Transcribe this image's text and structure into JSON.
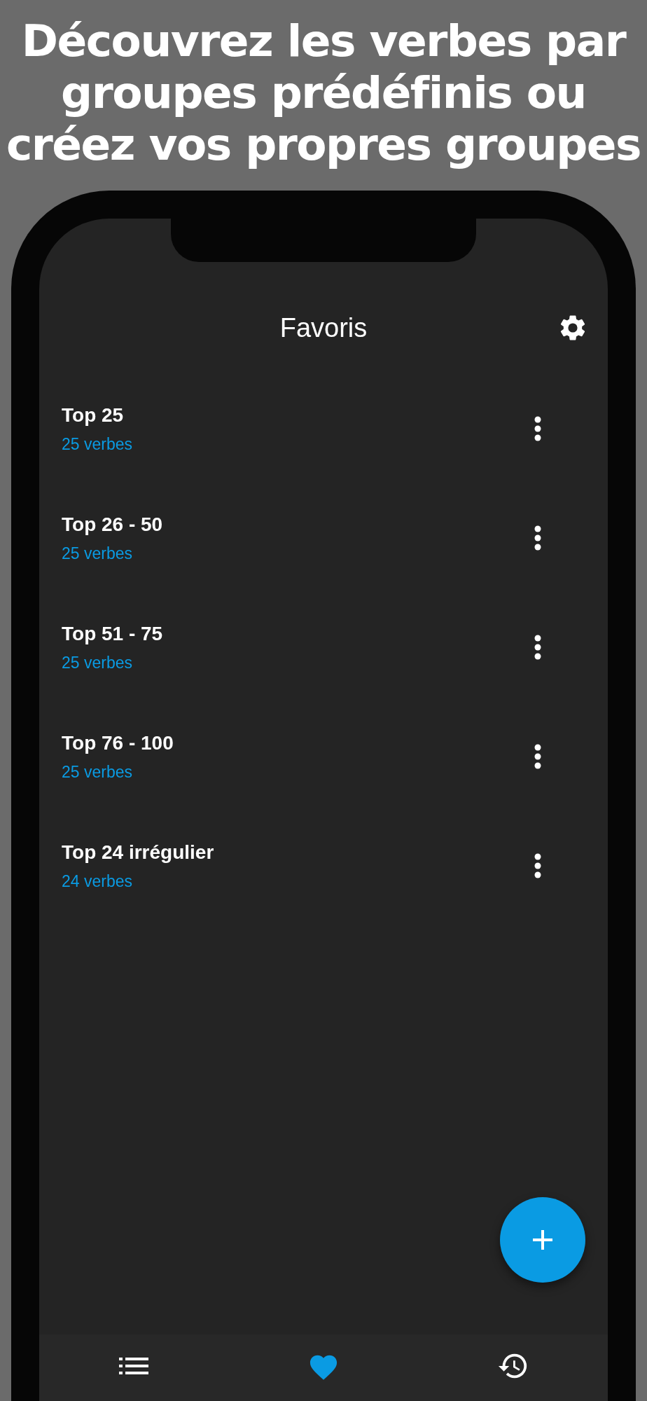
{
  "headline": "Découvrez les verbes par groupes prédéfinis ou créez vos propres groupes",
  "screen": {
    "title": "Favoris"
  },
  "groups": [
    {
      "name": "Top 25",
      "count": "25 verbes"
    },
    {
      "name": "Top 26 - 50",
      "count": "25 verbes"
    },
    {
      "name": "Top 51 - 75",
      "count": "25 verbes"
    },
    {
      "name": "Top 76 - 100",
      "count": "25 verbes"
    },
    {
      "name": "Top 24 irrégulier",
      "count": "24 verbes"
    }
  ],
  "nav": [
    {
      "kind": "list",
      "selected": false
    },
    {
      "kind": "heart",
      "selected": true
    },
    {
      "kind": "history",
      "selected": false
    }
  ]
}
